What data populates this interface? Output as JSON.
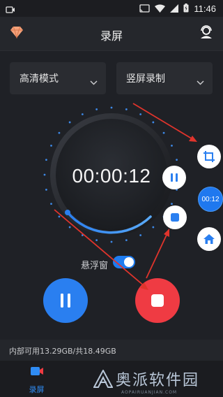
{
  "status_bar": {
    "time": "11:46",
    "icons": [
      "screen-record-icon",
      "cast-icon",
      "wifi-icon",
      "signal-icon",
      "battery-icon"
    ]
  },
  "app_bar": {
    "title": "录屏",
    "left_icon": "gem-icon",
    "right_icon": "user-service-icon"
  },
  "settings": {
    "quality_label": "高清模式",
    "orientation_label": "竖屏录制"
  },
  "recorder": {
    "elapsed": "00:00:12"
  },
  "floating_panel": {
    "timer_badge": "00:12"
  },
  "float_window": {
    "label": "悬浮窗",
    "enabled": true
  },
  "storage": {
    "text": "内部可用13.29GB/共18.49GB"
  },
  "bottom_nav": {
    "tabs": [
      {
        "label": "录屏",
        "icon": "video-camera-icon",
        "active": true
      }
    ]
  },
  "watermark": {
    "text": "奥派软件园",
    "subtext": "AOPAIRUANJIAN.COM"
  },
  "colors": {
    "background": "#1f2126",
    "accent_blue": "#2a7ff0",
    "stop_red": "#ef3b43",
    "annotation_red": "#e0342c"
  }
}
